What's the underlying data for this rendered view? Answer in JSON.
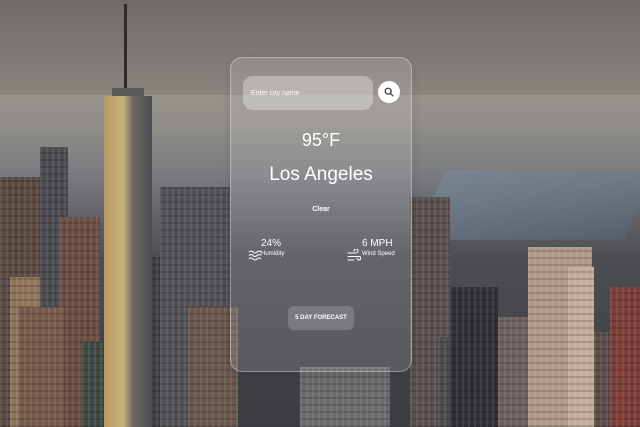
{
  "search": {
    "placeholder": "Enter city name",
    "value": ""
  },
  "weather": {
    "temperature": "95°F",
    "city": "Los Angeles",
    "condition": "Clear",
    "humidity_value": "24%",
    "humidity_label": "Humidity",
    "wind_value": "6 MPH",
    "wind_label": "Wind Speed"
  },
  "forecast": {
    "button_label": "5 DAY FORECAST"
  },
  "icons": {
    "search": "search-icon",
    "humidity": "humidity-icon",
    "wind": "wind-icon"
  },
  "colors": {
    "text": "#ffffff",
    "card_bg": "rgba(255,255,255,0.13)",
    "button_bg": "#ffffff"
  }
}
